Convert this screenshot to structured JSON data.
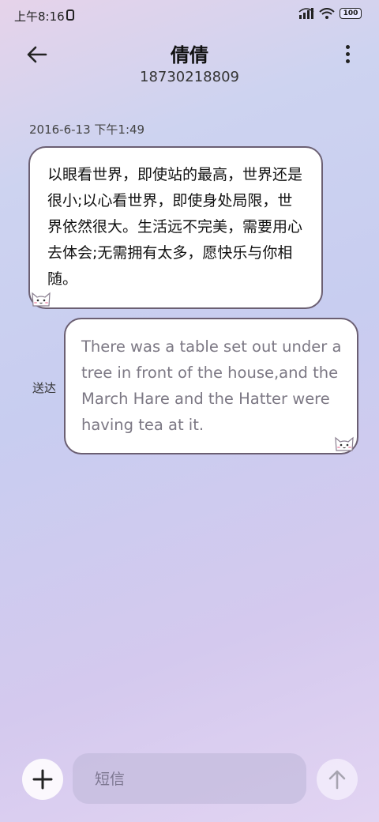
{
  "status_bar": {
    "time": "上午8:16",
    "battery": "100"
  },
  "header": {
    "contact_name": "倩倩",
    "contact_number": "18730218809"
  },
  "conversation": {
    "timestamp": "2016-6-13 下午1:49",
    "messages": [
      {
        "direction": "incoming",
        "text": "以眼看世界，即使站的最高，世界还是很小;以心看世界，即使身处局限，世界依然很大。生活远不完美，需要用心去体会;无需拥有太多，愿快乐与你相随。"
      },
      {
        "direction": "outgoing",
        "text": "There was a table set out under a tree in front of the house,and the March Hare and the Hatter were having tea at it.",
        "status": "送达"
      }
    ]
  },
  "composer": {
    "placeholder": "短信"
  },
  "icons": {
    "back": "arrow-left-icon",
    "more": "more-vertical-icon",
    "add": "plus-icon",
    "send": "arrow-up-icon"
  }
}
